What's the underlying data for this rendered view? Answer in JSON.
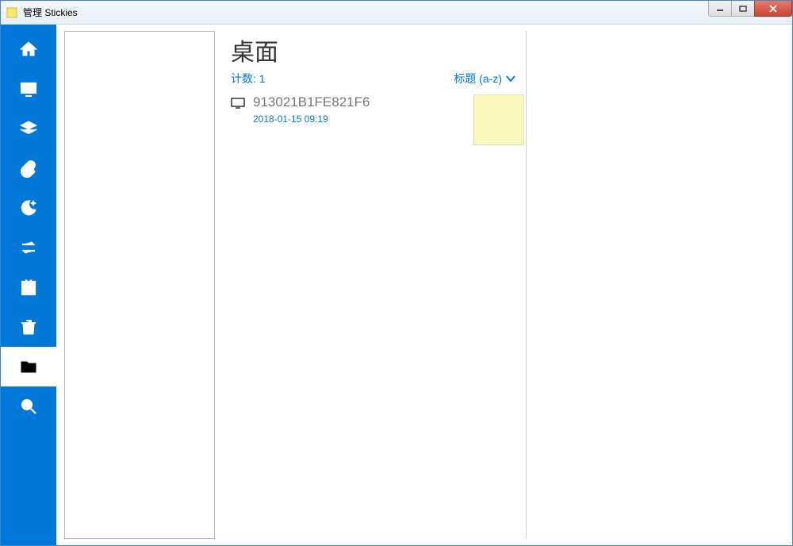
{
  "window": {
    "title": "管理 Stickies"
  },
  "main": {
    "heading": "桌面",
    "count_label": "计数: 1",
    "sort_label": "标题 (a-z)"
  },
  "note": {
    "title": "913021B1FE821F6",
    "date": "2018-01-15 09:19",
    "thumb_color": "#fbf8bd"
  },
  "sidebar": {
    "items": [
      {
        "name": "home",
        "selected": false
      },
      {
        "name": "desktop",
        "selected": false
      },
      {
        "name": "stack",
        "selected": false
      },
      {
        "name": "attach",
        "selected": false
      },
      {
        "name": "sleep",
        "selected": false
      },
      {
        "name": "recur",
        "selected": false
      },
      {
        "name": "store",
        "selected": false
      },
      {
        "name": "trash",
        "selected": false
      },
      {
        "name": "folder",
        "selected": true
      },
      {
        "name": "search",
        "selected": false
      }
    ]
  }
}
